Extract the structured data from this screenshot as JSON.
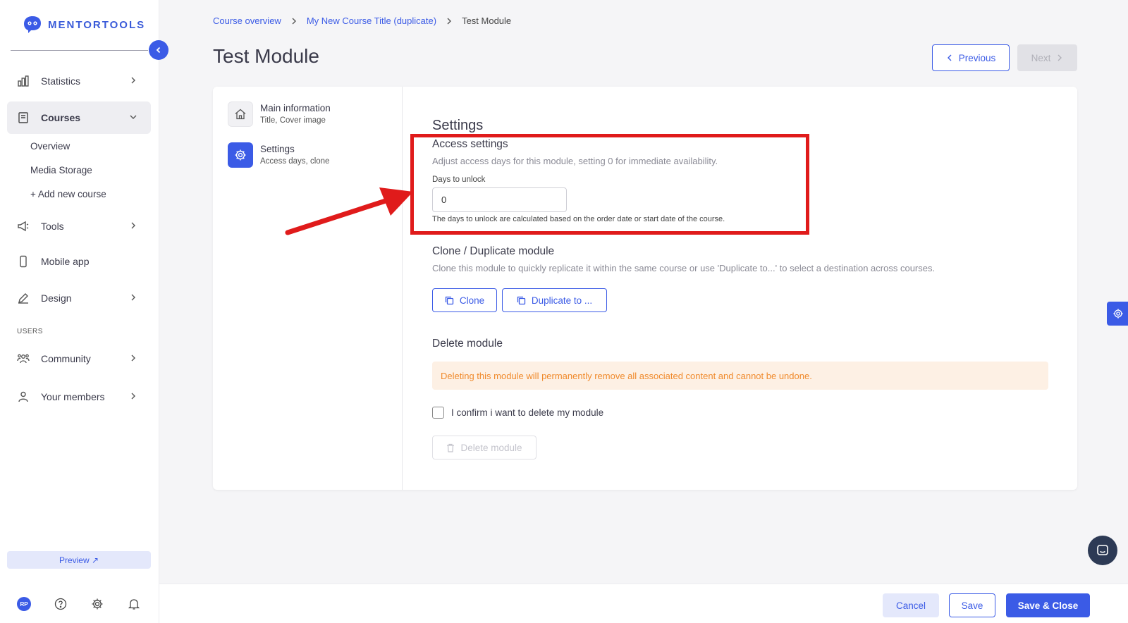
{
  "app": {
    "logo_text": "MENTORTOOLS"
  },
  "sidebar": {
    "items": [
      {
        "label": "Statistics"
      },
      {
        "label": "Courses"
      },
      {
        "label": "Tools"
      },
      {
        "label": "Mobile app"
      },
      {
        "label": "Design"
      },
      {
        "label": "Community"
      },
      {
        "label": "Your members"
      }
    ],
    "courses_sub": [
      "Overview",
      "Media Storage",
      "+ Add new course"
    ],
    "section_users": "USERS",
    "preview_label": "Preview ↗",
    "avatar_initials": "RP"
  },
  "breadcrumb": [
    "Course overview",
    "My New Course Title (duplicate)",
    "Test Module"
  ],
  "page": {
    "title": "Test Module",
    "previous_label": "Previous",
    "next_label": "Next"
  },
  "tabs": [
    {
      "title": "Main information",
      "sub": "Title, Cover image"
    },
    {
      "title": "Settings",
      "sub": "Access days, clone"
    }
  ],
  "settings": {
    "heading": "Settings",
    "access": {
      "heading": "Access settings",
      "desc": "Adjust access days for this module, setting 0 for immediate availability.",
      "field_label": "Days to unlock",
      "field_value": "0",
      "hint": "The days to unlock are calculated based on the order date or start date of the course."
    },
    "clone": {
      "heading": "Clone / Duplicate module",
      "desc": "Clone this module to quickly replicate it within the same course or use 'Duplicate to...' to select a destination across courses.",
      "clone_label": "Clone",
      "duplicate_label": "Duplicate to ..."
    },
    "delete": {
      "heading": "Delete module",
      "warning": "Deleting this module will permanently remove all associated content and cannot be undone.",
      "confirm_label": "I confirm i want to delete my module",
      "button_label": "Delete module"
    }
  },
  "footer": {
    "cancel": "Cancel",
    "save": "Save",
    "save_close": "Save & Close"
  },
  "colors": {
    "accent": "#3b5be6",
    "highlight": "#e01b1b",
    "warning_text": "#f08a2c",
    "warning_bg": "#fdf0e4"
  }
}
